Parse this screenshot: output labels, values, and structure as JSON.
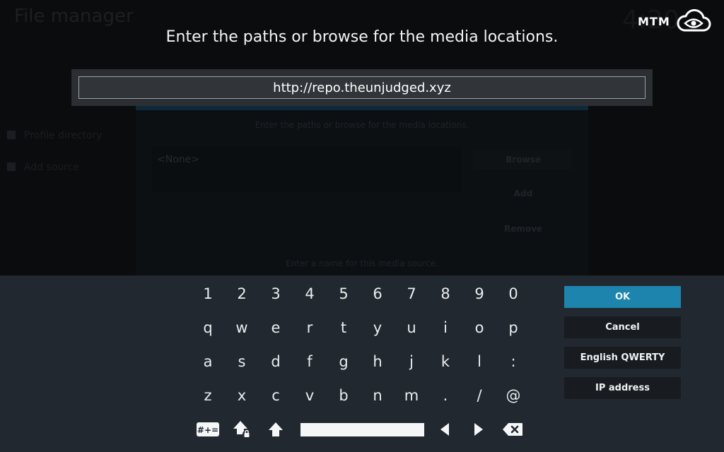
{
  "background": {
    "title": "File manager",
    "clock": "4:20",
    "sidebar": [
      "Profile directory",
      "Add source"
    ],
    "dialog_hint": "Enter the paths or browse for the media locations.",
    "path_value": "<None>",
    "buttons": [
      "Browse",
      "Add",
      "Remove"
    ],
    "name_hint": "Enter a name for this media source."
  },
  "header": {
    "prompt": "Enter the paths or browse for the media locations.",
    "brand": "MTM"
  },
  "input": {
    "value": "http://repo.theunjudged.xyz"
  },
  "keyboard": {
    "rows": [
      [
        "1",
        "2",
        "3",
        "4",
        "5",
        "6",
        "7",
        "8",
        "9",
        "0"
      ],
      [
        "q",
        "w",
        "e",
        "r",
        "t",
        "y",
        "u",
        "i",
        "o",
        "p"
      ],
      [
        "a",
        "s",
        "d",
        "f",
        "g",
        "h",
        "j",
        "k",
        "l",
        ":"
      ],
      [
        "z",
        "x",
        "c",
        "v",
        "b",
        "n",
        "m",
        ".",
        "/",
        "@"
      ]
    ],
    "icon_keys": [
      "symbols-icon",
      "caps-lock-icon",
      "shift-icon",
      "space-bar",
      "arrow-left-icon",
      "arrow-right-icon",
      "backspace-icon"
    ]
  },
  "side_buttons": {
    "ok": "OK",
    "cancel": "Cancel",
    "layout": "English QWERTY",
    "ip": "IP address"
  },
  "colors": {
    "accent": "#1d85ad",
    "panel": "#22282f",
    "button": "#181c21"
  }
}
